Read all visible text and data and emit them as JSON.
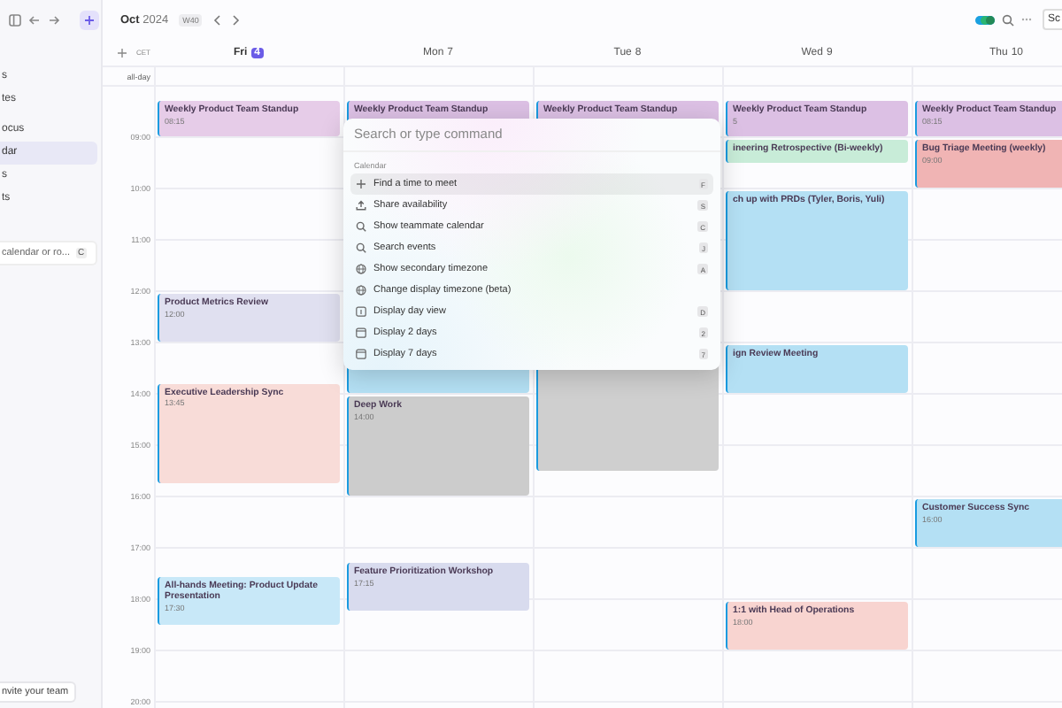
{
  "sidebar": {
    "items": [
      {
        "label": "s",
        "selected": false
      },
      {
        "label": "tes",
        "selected": false
      },
      {
        "label": "ocus",
        "selected": false
      },
      {
        "label": "dar",
        "selected": true
      },
      {
        "label": "s",
        "selected": false
      },
      {
        "label": "ts",
        "selected": false
      }
    ],
    "search": {
      "placeholder": "calendar or ro...",
      "shortcut": "C"
    },
    "invite_button": "nvite your team"
  },
  "toolbar": {
    "month": "Oct",
    "year": "2024",
    "week_badge": "W40",
    "share_button": "Sc"
  },
  "calendar": {
    "timezone": "CET",
    "allday_label": "all-day",
    "hours": [
      "09:00",
      "10:00",
      "11:00",
      "12:00",
      "13:00",
      "14:00",
      "15:00",
      "16:00",
      "17:00",
      "18:00",
      "19:00",
      "20:00"
    ],
    "days": [
      {
        "weekday": "Fri",
        "date": "4",
        "today": true,
        "events": [
          {
            "kind": "short",
            "title": "Weekly Product Team Standup",
            "time": "08:15",
            "color": "#e6cce8"
          },
          {
            "kind": "hour",
            "title": "Product Metrics Review",
            "time": "12:00",
            "color": "#e0e0f0"
          },
          {
            "kind": "double",
            "title": "Executive Leadership Sync",
            "time": "13:45",
            "color": "#f8dcd8"
          },
          {
            "kind": "hour",
            "title": "All-hands Meeting: Product Update Presentation",
            "time": "17:30",
            "color": "#c8e8f8"
          }
        ]
      },
      {
        "weekday": "Mon",
        "date": "7",
        "today": false,
        "events": [
          {
            "kind": "standup",
            "title": "Weekly Product Team Standup",
            "color": "#dcc0e4"
          },
          {
            "kind": "covered",
            "color": "#b4e0f4"
          },
          {
            "kind": "double",
            "title": "Deep Work",
            "time": "14:00",
            "color": "#cccccc"
          },
          {
            "kind": "hour",
            "title": "Feature Prioritization Workshop",
            "time": "17:15",
            "color": "#d8dbee"
          }
        ]
      },
      {
        "weekday": "Tue",
        "date": "8",
        "today": false,
        "events": [
          {
            "kind": "standup",
            "title": "Weekly Product Team Standup",
            "color": "#dcc0e4"
          },
          {
            "kind": "coveredlong",
            "color": "#cfcfcf"
          }
        ]
      },
      {
        "weekday": "Wed",
        "date": "9",
        "today": false,
        "events": [
          {
            "kind": "standup",
            "title": "Weekly Product Team Standup",
            "time": "5",
            "color": "#dcc0e4"
          },
          {
            "kind": "retro",
            "title": "ineering Retrospective (Bi-weekly)",
            "color": "#c8ecd8"
          },
          {
            "kind": "sync",
            "title": "ch up with PRDs (Tyler, Boris, Yuli)",
            "color": "#b4e0f4"
          },
          {
            "kind": "review",
            "title": "ign Review Meeting",
            "color": "#b4e0f4"
          },
          {
            "kind": "hour",
            "title": "1:1 with Head of Operations",
            "time": "18:00",
            "color": "#f8d4d0"
          }
        ]
      },
      {
        "weekday": "Thu",
        "date": "10",
        "today": false,
        "events": [
          {
            "kind": "short",
            "title": "Weekly Product Team Standup",
            "time": "08:15",
            "color": "#dcc0e4"
          },
          {
            "kind": "hour",
            "title": "Bug Triage Meeting (weekly)",
            "time": "09:00",
            "color": "#f0b4b4"
          },
          {
            "kind": "hour",
            "title": "Customer Success Sync",
            "time": "16:00",
            "color": "#b4e0f4"
          }
        ]
      }
    ]
  },
  "command_palette": {
    "placeholder": "Search or type command",
    "section": "Calendar",
    "commands": [
      {
        "kind": "create",
        "label": "Find a time to meet",
        "shortcut": "F",
        "selected": true
      },
      {
        "kind": "share",
        "label": "Share availability",
        "shortcut": "S",
        "selected": false
      },
      {
        "kind": "search",
        "label": "Show teammate calendar",
        "shortcut": "C",
        "selected": false
      },
      {
        "kind": "search",
        "label": "Search events",
        "shortcut": "J",
        "selected": false
      },
      {
        "kind": "timezone",
        "label": "Show secondary timezone",
        "shortcut": "A",
        "selected": false
      },
      {
        "kind": "timezone",
        "label": "Change display timezone (beta)",
        "selected": false
      },
      {
        "kind": "day",
        "label": "Display day view",
        "shortcut": "D",
        "selected": false
      },
      {
        "kind": "days",
        "label": "Display 2 days",
        "shortcut": "2",
        "selected": false
      },
      {
        "kind": "days",
        "label": "Display 7 days",
        "shortcut": "7",
        "selected": false
      }
    ]
  }
}
